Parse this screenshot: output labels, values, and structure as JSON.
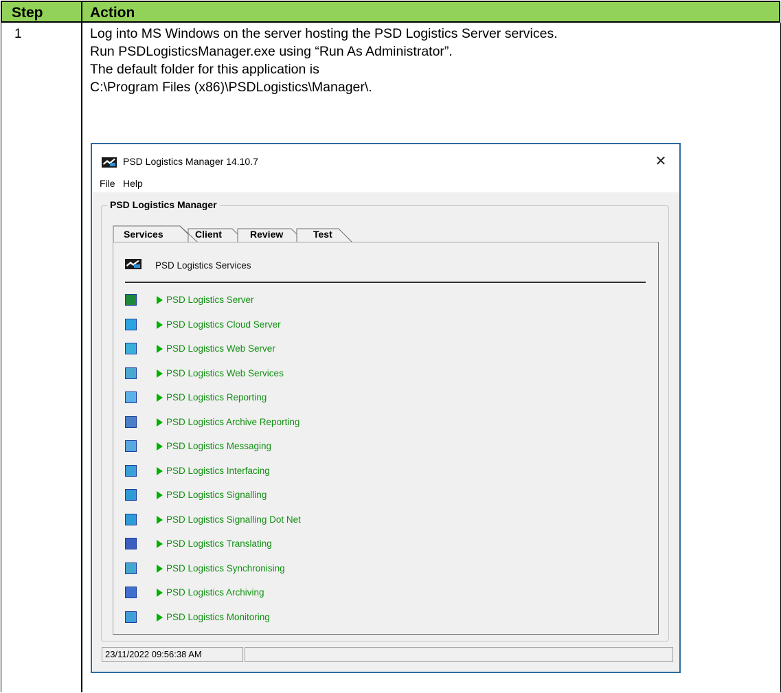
{
  "table": {
    "header_step": "Step",
    "header_action": "Action",
    "step_number": "1",
    "action_lines": [
      "Log into MS Windows on the server hosting the PSD Logistics Server services.",
      "Run PSDLogisticsManager.exe using “Run As Administrator”.",
      "The default folder for this application is",
      "C:\\Program Files (x86)\\PSDLogistics\\Manager\\."
    ],
    "header_color": "#93d259"
  },
  "app": {
    "window_title": "PSD Logistics Manager 14.10.7",
    "menu": [
      "File",
      "Help"
    ],
    "group_label": "PSD Logistics Manager",
    "tabs": [
      "Services",
      "Client",
      "Review",
      "Test"
    ],
    "active_tab": "Services",
    "services_header": "PSD Logistics Services",
    "services": [
      {
        "label": "PSD Logistics Server",
        "icon": "globe-icon",
        "color": "#1d8a3a"
      },
      {
        "label": "PSD Logistics Cloud Server",
        "icon": "cloud-icon",
        "color": "#2aa3e0"
      },
      {
        "label": "PSD Logistics Web Server",
        "icon": "web-icon",
        "color": "#3ab0d8"
      },
      {
        "label": "PSD Logistics Web Services",
        "icon": "web-services-icon",
        "color": "#4aa8d0"
      },
      {
        "label": "PSD Logistics Reporting",
        "icon": "report-icon",
        "color": "#5bb2e8"
      },
      {
        "label": "PSD Logistics Archive Reporting",
        "icon": "archive-report-icon",
        "color": "#4a7fc8"
      },
      {
        "label": "PSD Logistics Messaging",
        "icon": "envelope-icon",
        "color": "#58a8e0"
      },
      {
        "label": "PSD Logistics Interfacing",
        "icon": "interface-icon",
        "color": "#3aa0d8"
      },
      {
        "label": "PSD Logistics Signalling",
        "icon": "signal-icon",
        "color": "#2f9bd6"
      },
      {
        "label": "PSD Logistics Signalling Dot Net",
        "icon": "signal-dotnet-icon",
        "color": "#2f9bd6"
      },
      {
        "label": "PSD Logistics Translating",
        "icon": "translate-icon",
        "color": "#3b5fc0"
      },
      {
        "label": "PSD Logistics Synchronising",
        "icon": "sync-icon",
        "color": "#45a7cf"
      },
      {
        "label": "PSD Logistics Archiving",
        "icon": "archive-icon",
        "color": "#3f6fcf"
      },
      {
        "label": "PSD Logistics Monitoring",
        "icon": "monitor-icon",
        "color": "#3fa0d8"
      }
    ],
    "status_datetime": "23/11/2022 09:56:38 AM",
    "status_right": ""
  }
}
